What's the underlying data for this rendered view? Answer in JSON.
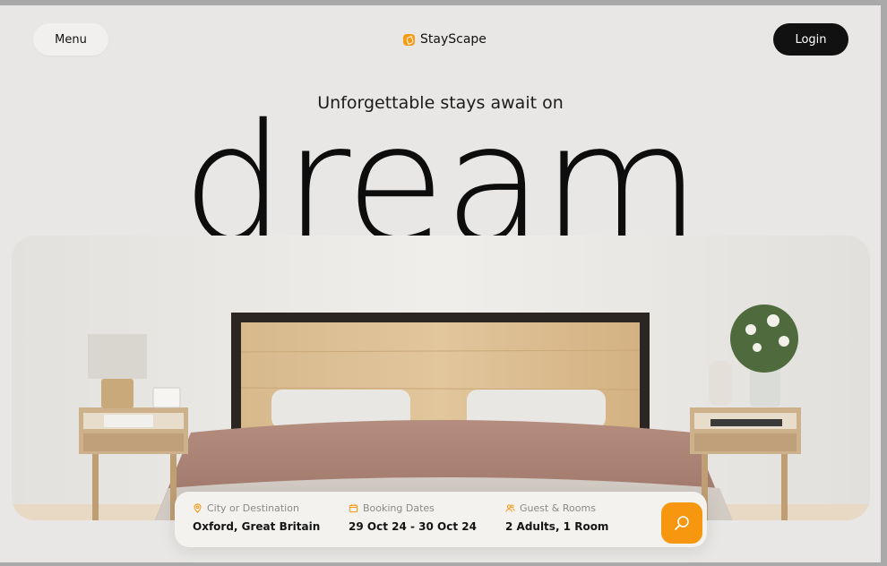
{
  "nav": {
    "menu_label": "Menu",
    "brand_name": "StayScape",
    "login_label": "Login"
  },
  "hero": {
    "subtitle": "Unforgettable stays await on",
    "headline": "dream stay"
  },
  "search": {
    "destination": {
      "label": "City or Destination",
      "value": "Oxford, Great Britain",
      "icon": "map-pin-icon"
    },
    "dates": {
      "label": "Booking Dates",
      "value": "29 Oct 24 - 30 Oct 24",
      "icon": "calendar-icon"
    },
    "guests": {
      "label": "Guest & Rooms",
      "value": "2 Adults, 1 Room",
      "icon": "users-icon"
    },
    "submit_icon": "search-icon"
  },
  "colors": {
    "accent": "#f7960f",
    "background": "#e8e7e5",
    "dark": "#111111"
  }
}
